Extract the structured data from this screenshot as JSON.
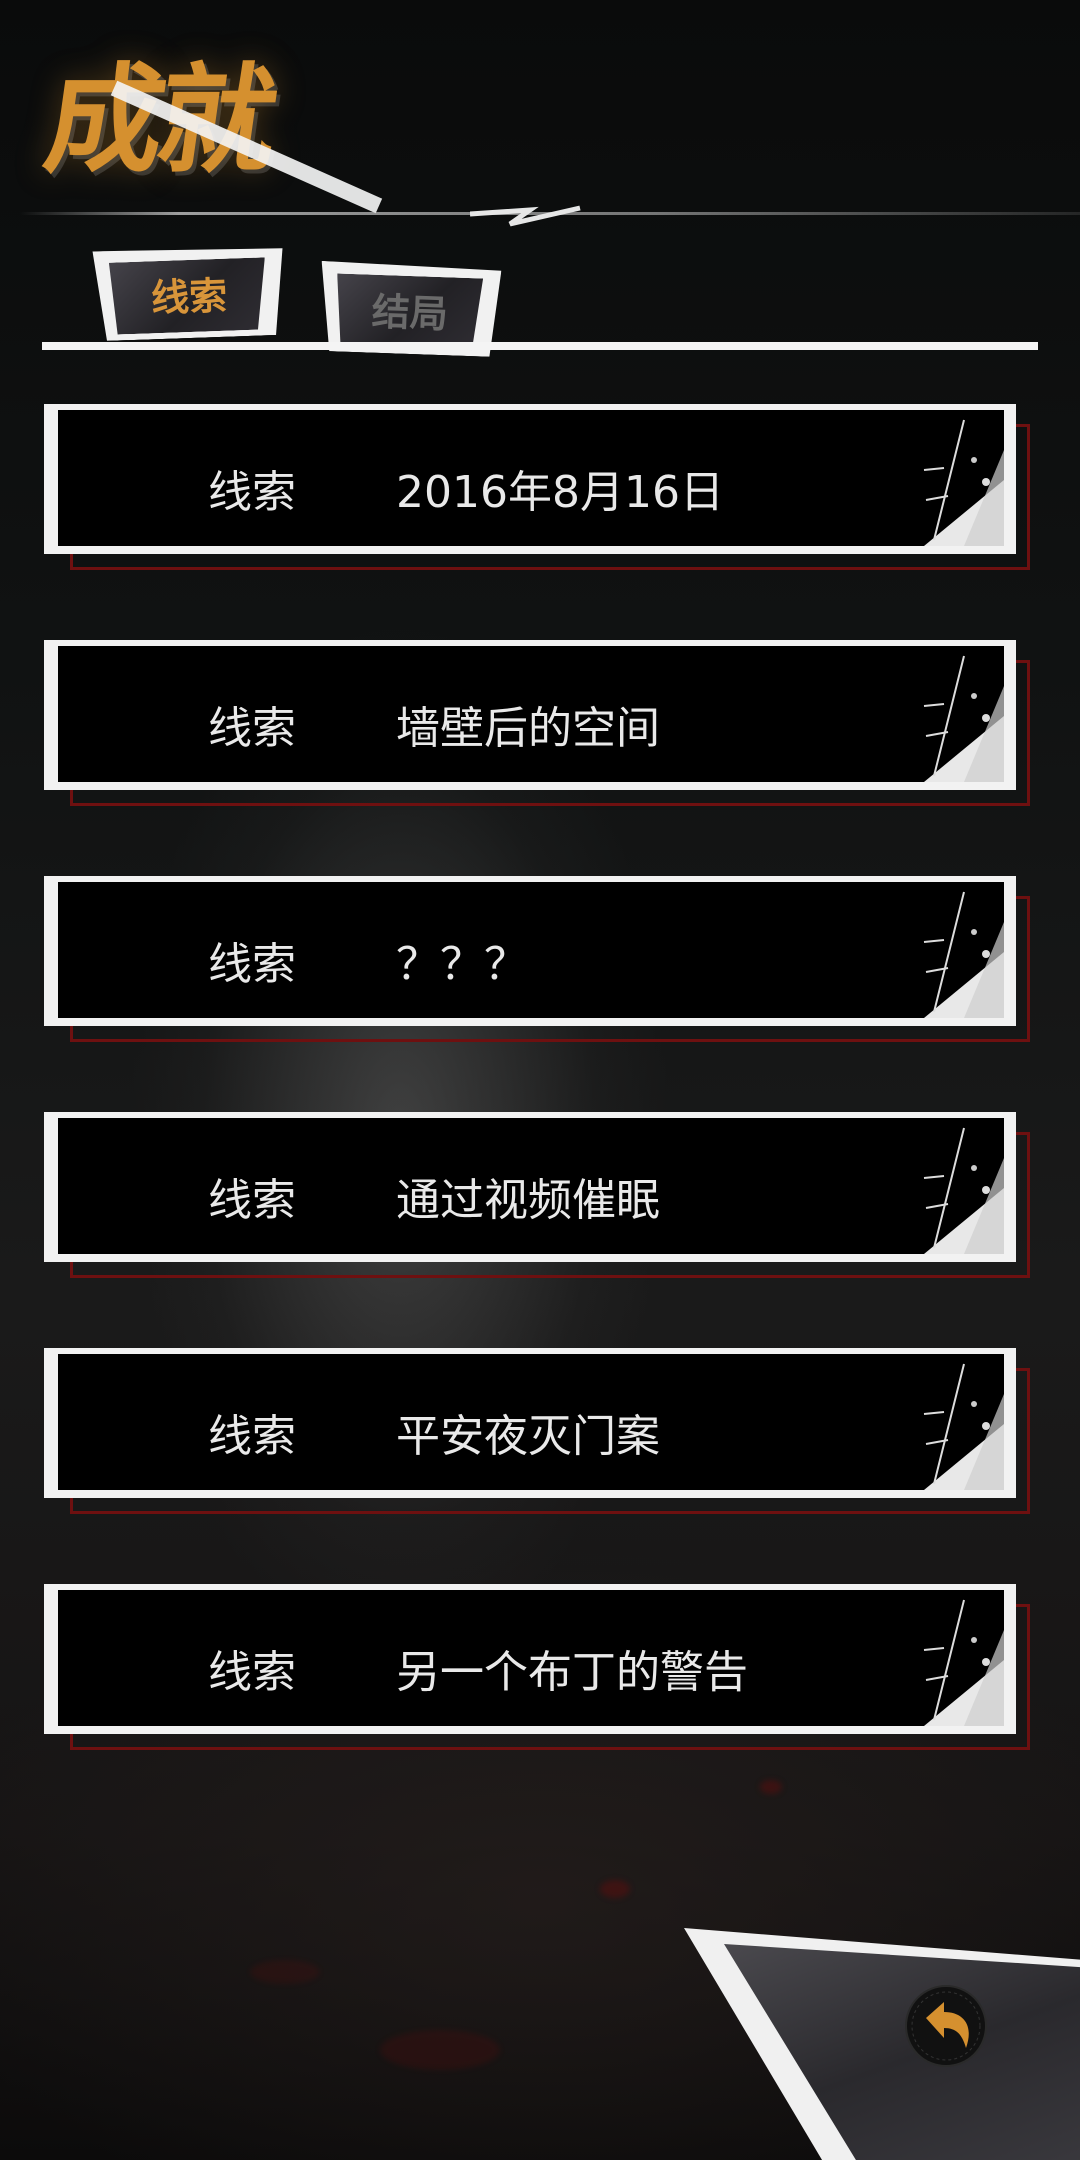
{
  "header": {
    "title": "成就"
  },
  "tabs": [
    {
      "label": "线索",
      "active": true
    },
    {
      "label": "结局",
      "active": false
    }
  ],
  "clues": [
    {
      "tag": "线索",
      "title": "2016年8月16日"
    },
    {
      "tag": "线索",
      "title": "墙壁后的空间"
    },
    {
      "tag": "线索",
      "title": "？？？"
    },
    {
      "tag": "线索",
      "title": "通过视频催眠"
    },
    {
      "tag": "线索",
      "title": "平安夜灭门案"
    },
    {
      "tag": "线索",
      "title": "另一个布丁的警告"
    }
  ],
  "back_button": {
    "icon": "back-arrow-icon"
  },
  "colors": {
    "accent": "#d5902f",
    "card_border": "#f2f2f2",
    "card_shadow": "#6e1010",
    "inactive_tab": "#6a6a6a"
  }
}
